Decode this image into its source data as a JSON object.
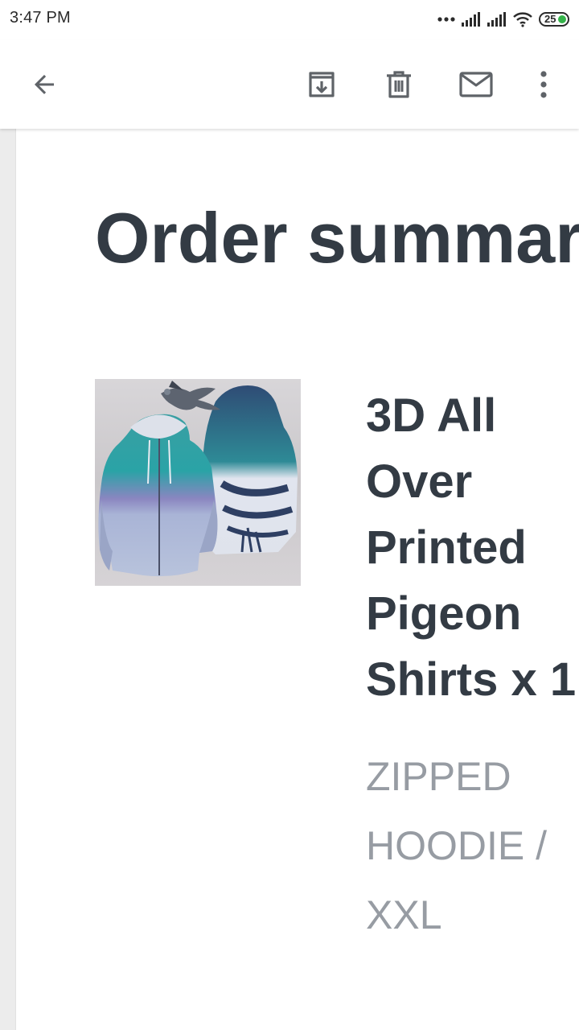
{
  "status_bar": {
    "time": "3:47 PM",
    "battery_level": "25",
    "icons": [
      "more-dots-icon",
      "signal-icon",
      "signal-icon",
      "wifi-icon",
      "battery-icon"
    ]
  },
  "toolbar": {
    "icons": [
      "back-arrow-icon",
      "archive-icon",
      "trash-icon",
      "mail-icon",
      "more-vert-icon"
    ]
  },
  "email": {
    "heading": "Order summar",
    "product": {
      "title_lines": [
        "3D All",
        "Over",
        "Printed",
        "Pigeon",
        "Shirts x 1"
      ],
      "variant_lines": [
        "ZIPPED",
        "HOODIE /",
        "XXL"
      ]
    }
  },
  "colors": {
    "heading_text": "#333b44",
    "variant_text": "#979ca3",
    "icon": "#5f6368",
    "battery_green": "#35b34a",
    "rail": "#ececec"
  }
}
